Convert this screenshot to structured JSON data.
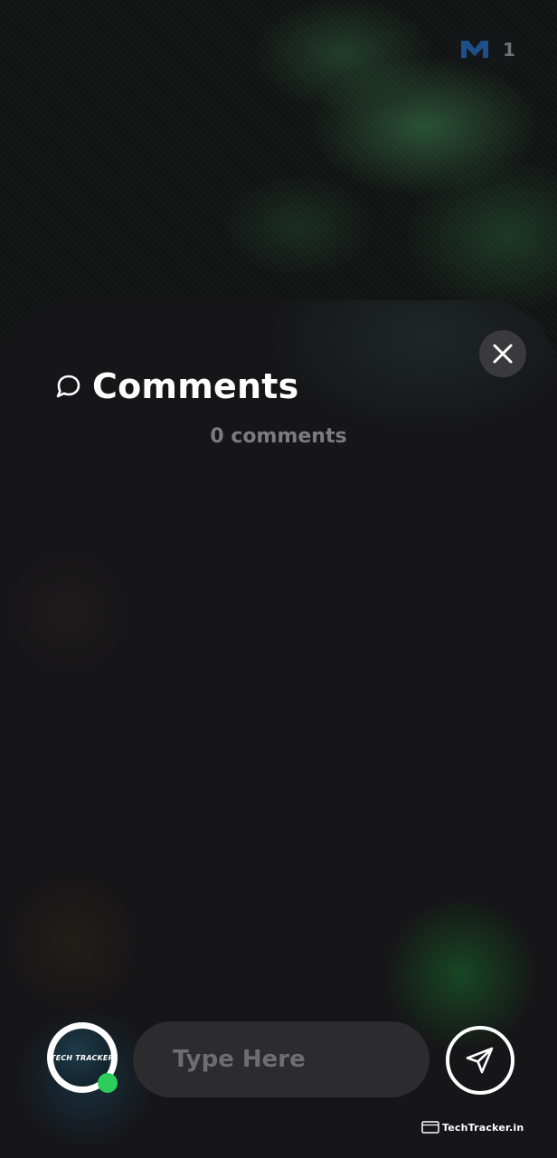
{
  "header_badge": {
    "count": "1",
    "logo_icon": "m-logo-icon"
  },
  "comments_sheet": {
    "title": "Comments",
    "count_text": "0 comments",
    "close_icon": "close-icon",
    "title_icon": "chat-bubble-icon"
  },
  "composer": {
    "placeholder": "Type Here",
    "value": "",
    "avatar_text": "TECH TRACKER",
    "online_status_color": "#2ecc5a",
    "send_icon": "send-icon"
  },
  "watermark": {
    "text": "TechTracker.in"
  }
}
